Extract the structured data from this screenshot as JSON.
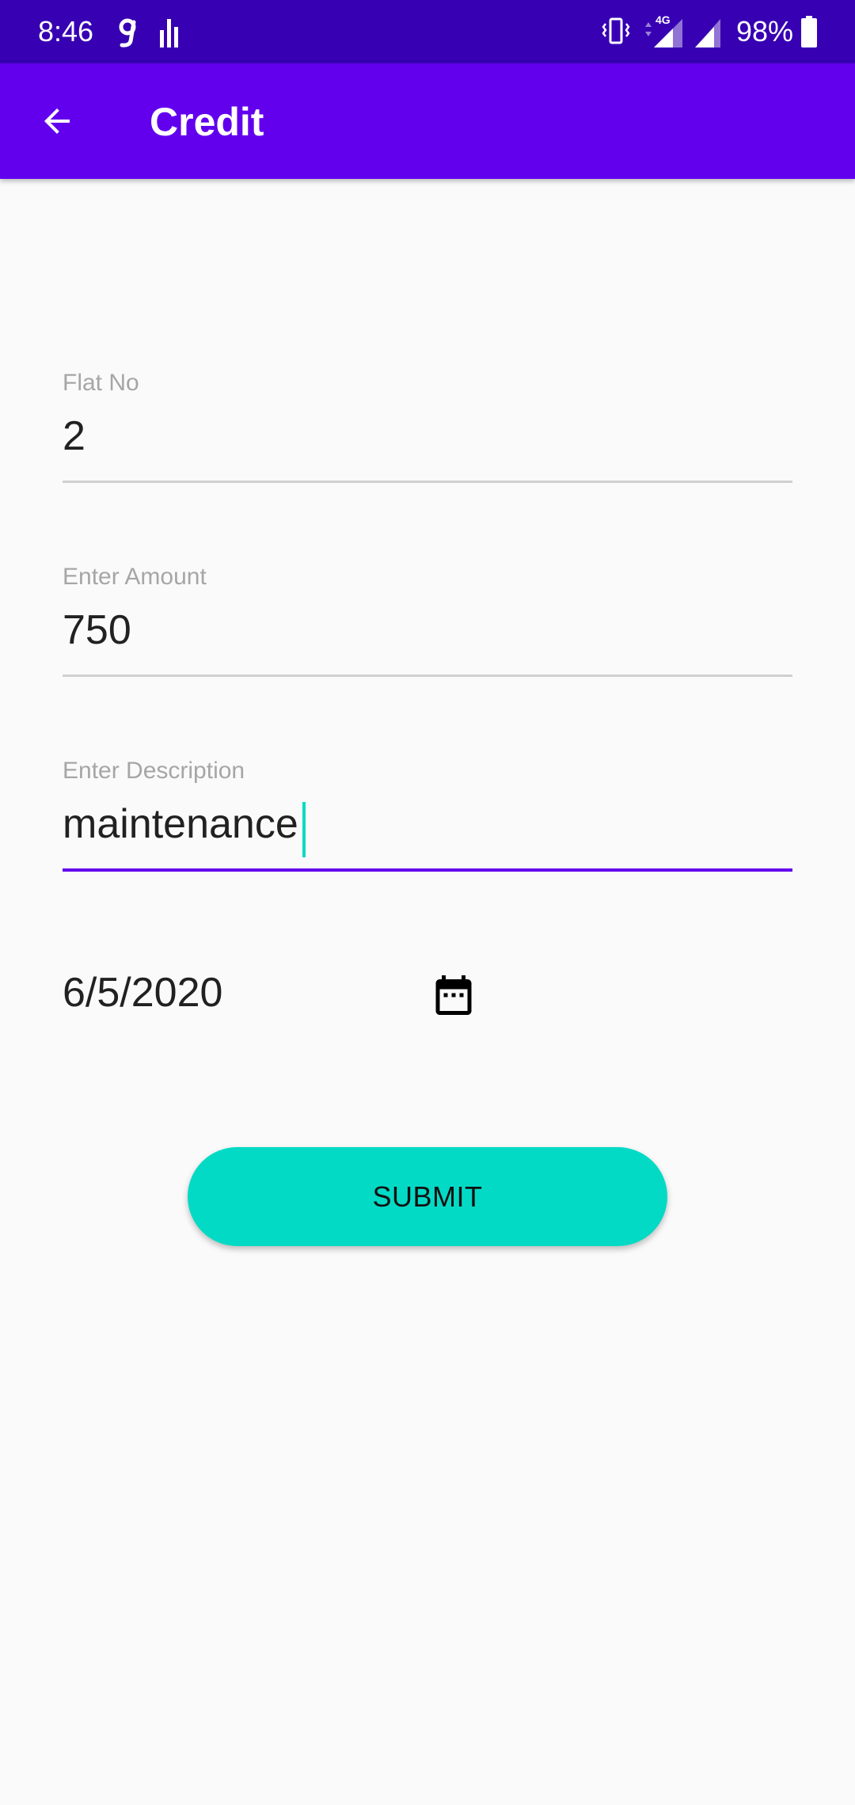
{
  "status_bar": {
    "time": "8:46",
    "battery_percent": "98%",
    "network_type": "4G",
    "icons": [
      "g-app-icon",
      "bar-chart-icon",
      "vibrate-icon",
      "signal-4g-icon",
      "signal-icon",
      "battery-icon"
    ]
  },
  "app_bar": {
    "title": "Credit",
    "back_icon": "arrow-back-icon",
    "background": "#6200ee",
    "status_background": "#3700b3"
  },
  "form": {
    "flat_no": {
      "label": "Flat No",
      "value": "2"
    },
    "amount": {
      "label": "Enter Amount",
      "value": "750"
    },
    "description": {
      "label": "Enter Description",
      "value": "maintenance",
      "focused": true
    },
    "date": {
      "value": "6/5/2020",
      "icon": "calendar-icon"
    },
    "submit_label": "SUBMIT"
  },
  "colors": {
    "accent": "#03dac5",
    "primary": "#6200ee",
    "background": "#fafafa"
  }
}
